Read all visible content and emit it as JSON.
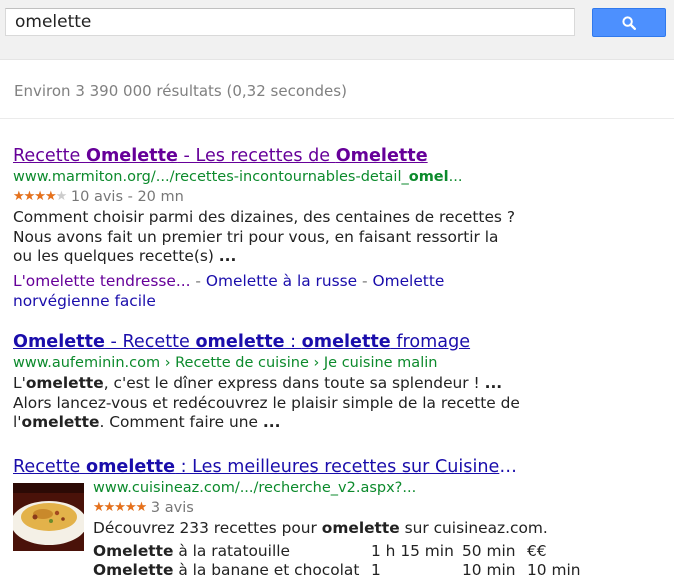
{
  "search": {
    "query": "omelette"
  },
  "stats": "Environ 3 390 000 résultats (0,32 secondes)",
  "results": [
    {
      "title_parts": [
        {
          "t": "Recette ",
          "b": false
        },
        {
          "t": "Omelette",
          "b": true
        },
        {
          "t": " - Les recettes de ",
          "b": false
        },
        {
          "t": "Omelette",
          "b": true
        }
      ],
      "visited": true,
      "url_parts": [
        {
          "t": "www.marmiton.org/.../recettes-incontournables-detail_",
          "b": false
        },
        {
          "t": "omel",
          "b": true
        },
        {
          "t": "...",
          "b": false
        }
      ],
      "rating": 4,
      "rating_max": 5,
      "meta": "10 avis - 20 mn",
      "snippet_lines": [
        [
          {
            "t": "Comment choisir parmi des dizaines, des centaines de recettes ?",
            "b": false
          }
        ],
        [
          {
            "t": "Nous avons fait un premier tri pour vous, en faisant ressortir la",
            "b": false
          }
        ],
        [
          {
            "t": "ou les quelques recette(s) ",
            "b": false
          },
          {
            "t": "...",
            "b": true
          }
        ]
      ],
      "sitelinks": [
        {
          "label": "L'omelette tendresse...",
          "visited": true
        },
        {
          "label": "Omelette à la russe",
          "visited": false
        },
        {
          "label": "Omelette norvégienne facile",
          "visited": false
        }
      ],
      "sitelink_separator": " - "
    },
    {
      "title_parts": [
        {
          "t": "Omelette",
          "b": true
        },
        {
          "t": " - Recette ",
          "b": false
        },
        {
          "t": "omelette",
          "b": true
        },
        {
          "t": " : ",
          "b": false
        },
        {
          "t": "omelette",
          "b": true
        },
        {
          "t": " fromage",
          "b": false
        }
      ],
      "visited": false,
      "url_parts": [
        {
          "t": "www.aufeminin.com › Recette de cuisine › Je cuisine malin",
          "b": false
        }
      ],
      "snippet_lines": [
        [
          {
            "t": "L'",
            "b": false
          },
          {
            "t": "omelette",
            "b": true
          },
          {
            "t": ", c'est le dîner express dans toute sa splendeur ! ",
            "b": false
          },
          {
            "t": "...",
            "b": true
          }
        ],
        [
          {
            "t": "Alors lancez-vous et redécouvrez le plaisir simple de la recette de",
            "b": false
          }
        ],
        [
          {
            "t": "l'",
            "b": false
          },
          {
            "t": "omelette",
            "b": true
          },
          {
            "t": ". Comment faire une ",
            "b": false
          },
          {
            "t": "...",
            "b": true
          }
        ]
      ]
    },
    {
      "title_parts": [
        {
          "t": "Recette ",
          "b": false
        },
        {
          "t": "omelette",
          "b": true
        },
        {
          "t": " : Les meilleures recettes sur Cuisineaz",
          "b": false
        }
      ],
      "visited": false,
      "url_parts": [
        {
          "t": "www.cuisineaz.com/.../recherche_v2.aspx?...",
          "b": false
        }
      ],
      "rating": 5,
      "rating_max": 5,
      "meta": "3 avis",
      "snippet_lines": [
        [
          {
            "t": "Découvrez 233 recettes pour ",
            "b": false
          },
          {
            "t": "omelette",
            "b": true
          },
          {
            "t": " sur cuisineaz.com.",
            "b": false
          }
        ]
      ],
      "recipes": [
        {
          "name_bold": "Omelette",
          "name_rest": " à la ratatouille",
          "total": "1 h 15 min",
          "prep": "50 min",
          "cost": "€€"
        },
        {
          "name_bold": "Omelette",
          "name_rest": " à la banane et chocolat",
          "total": "1",
          "prep": "10 min",
          "cost": "10 min"
        }
      ]
    }
  ],
  "colors": {
    "visited_link": "#660099",
    "link": "#1a0dab",
    "url_green": "#0c8a2c",
    "star_orange": "#e7711b",
    "search_button": "#4d90fe"
  }
}
